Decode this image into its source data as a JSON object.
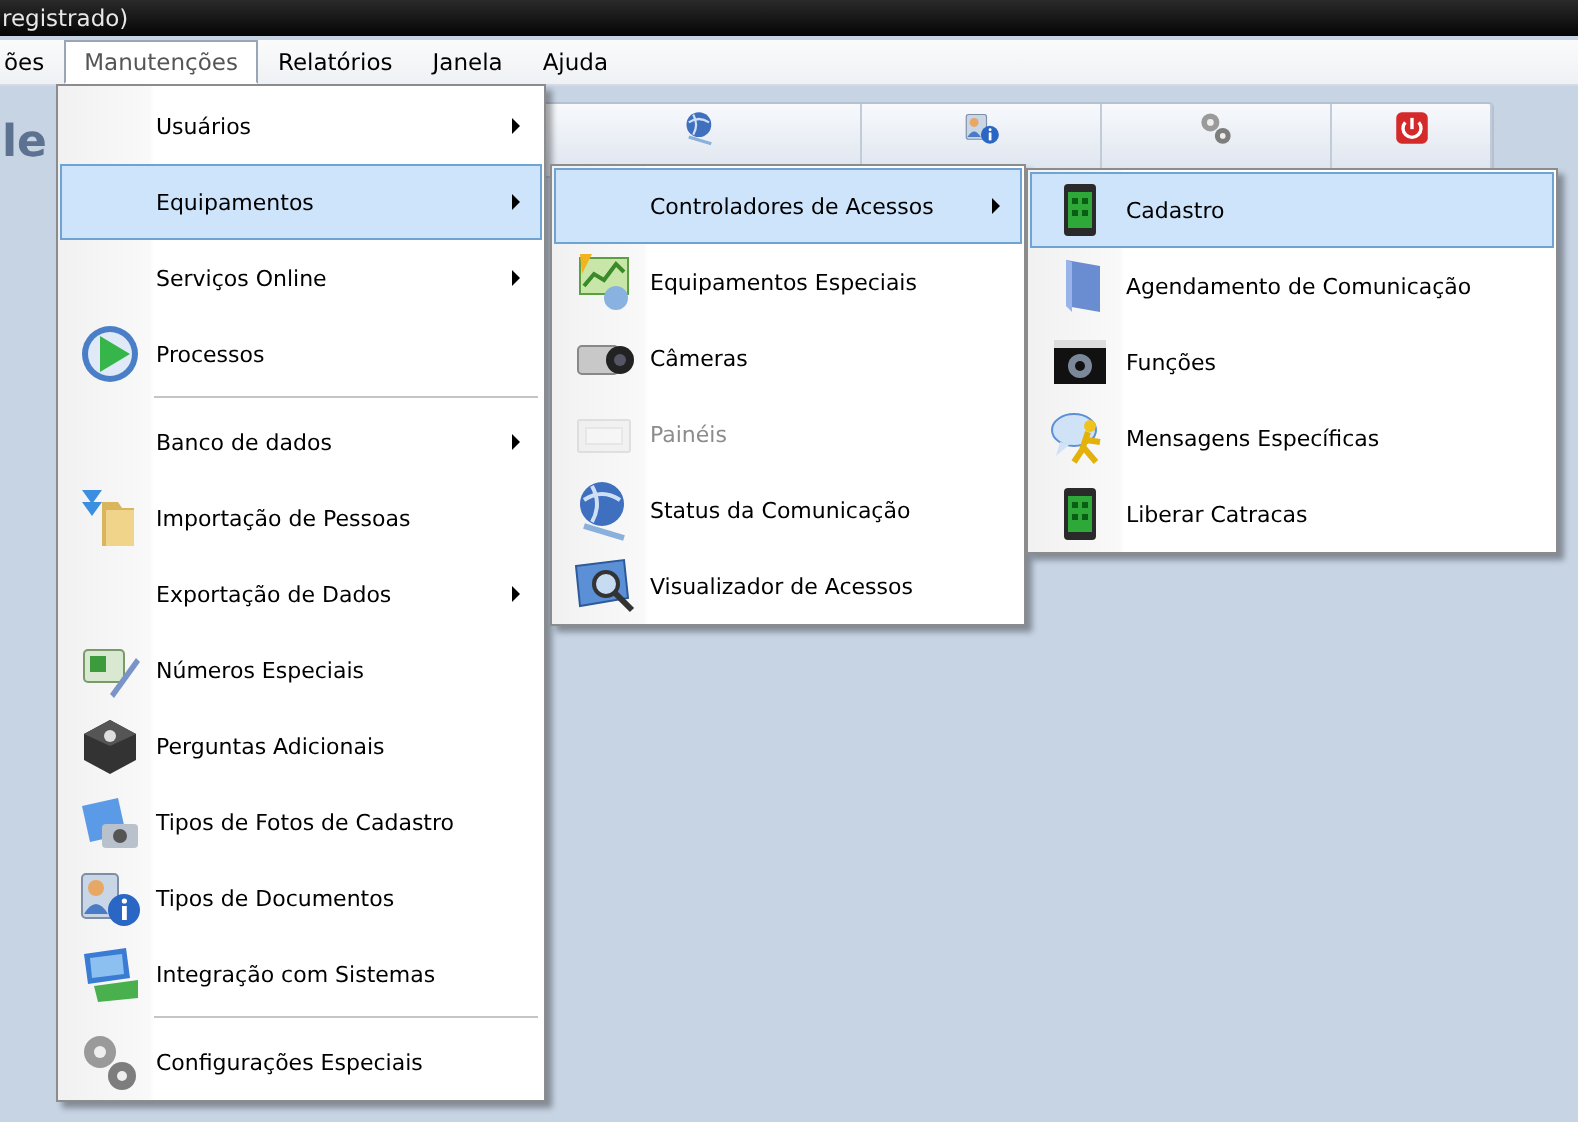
{
  "window": {
    "title": "registrado)"
  },
  "menubar": [
    {
      "label": "ões",
      "selected": false
    },
    {
      "label": "Manutenções",
      "selected": true
    },
    {
      "label": "Relatórios",
      "selected": false
    },
    {
      "label": "Janela",
      "selected": false
    },
    {
      "label": "Ajuda",
      "selected": false
    }
  ],
  "app_name": "le",
  "menus": [
    {
      "items": [
        {
          "kind": "item",
          "label": "Usuários",
          "submenu": true,
          "selected": false,
          "disabled": false
        },
        {
          "kind": "item",
          "label": "Equipamentos",
          "submenu": true,
          "selected": true,
          "disabled": false
        },
        {
          "kind": "item",
          "label": "Serviços Online",
          "submenu": true,
          "selected": false,
          "disabled": false
        },
        {
          "kind": "item",
          "label": "Processos",
          "submenu": false,
          "selected": false,
          "disabled": false
        },
        {
          "kind": "separator"
        },
        {
          "kind": "item",
          "label": "Banco de dados",
          "submenu": true,
          "selected": false,
          "disabled": false
        },
        {
          "kind": "item",
          "label": "Importação de Pessoas",
          "submenu": false,
          "selected": false,
          "disabled": false
        },
        {
          "kind": "item",
          "label": "Exportação de Dados",
          "submenu": true,
          "selected": false,
          "disabled": false
        },
        {
          "kind": "item",
          "label": "Números Especiais",
          "submenu": false,
          "selected": false,
          "disabled": false
        },
        {
          "kind": "item",
          "label": "Perguntas Adicionais",
          "submenu": false,
          "selected": false,
          "disabled": false
        },
        {
          "kind": "item",
          "label": "Tipos de Fotos de Cadastro",
          "submenu": false,
          "selected": false,
          "disabled": false
        },
        {
          "kind": "item",
          "label": "Tipos de Documentos",
          "submenu": false,
          "selected": false,
          "disabled": false
        },
        {
          "kind": "item",
          "label": "Integração com Sistemas",
          "submenu": false,
          "selected": false,
          "disabled": false
        },
        {
          "kind": "separator"
        },
        {
          "kind": "item",
          "label": "Configurações Especiais",
          "submenu": false,
          "selected": false,
          "disabled": false
        }
      ]
    },
    {
      "items": [
        {
          "kind": "item",
          "label": "Controladores de Acessos",
          "submenu": true,
          "selected": true,
          "disabled": false
        },
        {
          "kind": "item",
          "label": "Equipamentos Especiais",
          "submenu": false,
          "selected": false,
          "disabled": false
        },
        {
          "kind": "item",
          "label": "Câmeras",
          "submenu": false,
          "selected": false,
          "disabled": false
        },
        {
          "kind": "item",
          "label": "Painéis",
          "submenu": false,
          "selected": false,
          "disabled": true
        },
        {
          "kind": "item",
          "label": "Status da Comunicação",
          "submenu": false,
          "selected": false,
          "disabled": false
        },
        {
          "kind": "item",
          "label": "Visualizador de Acessos",
          "submenu": false,
          "selected": false,
          "disabled": false
        }
      ]
    },
    {
      "items": [
        {
          "kind": "item",
          "label": "Cadastro",
          "submenu": false,
          "selected": true,
          "disabled": false
        },
        {
          "kind": "item",
          "label": "Agendamento de Comunicação",
          "submenu": false,
          "selected": false,
          "disabled": false
        },
        {
          "kind": "item",
          "label": "Funções",
          "submenu": false,
          "selected": false,
          "disabled": false
        },
        {
          "kind": "item",
          "label": "Mensagens Específicas",
          "submenu": false,
          "selected": false,
          "disabled": false
        },
        {
          "kind": "item",
          "label": "Liberar Catracas",
          "submenu": false,
          "selected": false,
          "disabled": false
        }
      ]
    }
  ]
}
